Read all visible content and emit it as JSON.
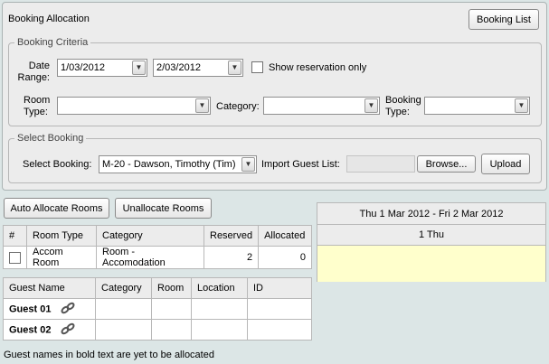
{
  "panel": {
    "title": "Booking Allocation",
    "booking_list_button": "Booking List"
  },
  "criteria": {
    "legend": "Booking Criteria",
    "date_range_label_1": "Date",
    "date_range_label_2": "Range:",
    "date_from": "1/03/2012",
    "date_to": "2/03/2012",
    "show_reservation_label": "Show reservation only",
    "room_type_label_1": "Room",
    "room_type_label_2": "Type:",
    "room_type_value": "",
    "category_label": "Category:",
    "category_value": "",
    "booking_type_label_1": "Booking",
    "booking_type_label_2": "Type:",
    "booking_type_value": ""
  },
  "select_booking": {
    "legend": "Select Booking",
    "label": "Select Booking:",
    "value": "M-20 - Dawson, Timothy (Tim)",
    "import_label": "Import Guest List:",
    "browse_button": "Browse...",
    "upload_button": "Upload"
  },
  "actions": {
    "auto_allocate": "Auto Allocate Rooms",
    "unallocate": "Unallocate Rooms"
  },
  "rooms_table": {
    "headers": [
      "#",
      "Room Type",
      "Category",
      "Reserved",
      "Allocated"
    ],
    "rows": [
      {
        "room_type": "Accom Room",
        "category": "Room - Accomodation",
        "reserved": "2",
        "allocated": "0"
      }
    ]
  },
  "guests_table": {
    "headers": [
      "Guest Name",
      "Category",
      "Room",
      "Location",
      "ID"
    ],
    "rows": [
      {
        "name": "Guest 01",
        "icon": "link-icon"
      },
      {
        "name": "Guest 02",
        "icon": "link-icon"
      }
    ]
  },
  "footnote": "Guest names in bold text are yet to be allocated",
  "calendar": {
    "range": "Thu 1 Mar 2012 - Fri 2 Mar 2012",
    "day": "1 Thu",
    "cell_color": "#ffffcc"
  }
}
